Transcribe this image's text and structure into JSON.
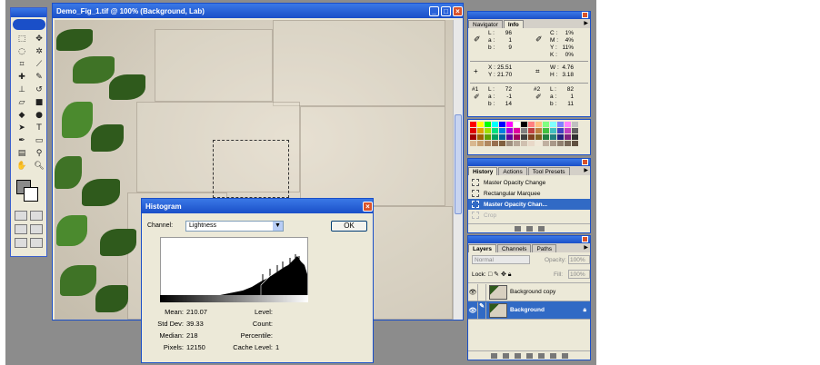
{
  "document": {
    "title": "Demo_Fig_1.tif @ 100% (Background, Lab)"
  },
  "histogram": {
    "title": "Histogram",
    "channel_label": "Channel:",
    "channel_value": "Lightness",
    "ok_label": "OK",
    "stats_left": [
      {
        "k": "Mean:",
        "v": "210.07"
      },
      {
        "k": "Std Dev:",
        "v": "39.33"
      },
      {
        "k": "Median:",
        "v": "218"
      },
      {
        "k": "Pixels:",
        "v": "12150"
      }
    ],
    "stats_right": [
      {
        "k": "Level:",
        "v": ""
      },
      {
        "k": "Count:",
        "v": ""
      },
      {
        "k": "Percentile:",
        "v": ""
      },
      {
        "k": "Cache Level:",
        "v": "1"
      }
    ]
  },
  "navigator": {
    "tabs": [
      "Navigator",
      "Info"
    ],
    "active_tab": "Info",
    "lab": [
      {
        "l": "L :",
        "v": "96"
      },
      {
        "l": "a :",
        "v": "1"
      },
      {
        "l": "b :",
        "v": "9"
      }
    ],
    "cmyk": [
      {
        "l": "C :",
        "v": "1%"
      },
      {
        "l": "M :",
        "v": "4%"
      },
      {
        "l": "Y :",
        "v": "11%"
      },
      {
        "l": "K :",
        "v": "0%"
      }
    ],
    "xy": [
      {
        "l": "X :",
        "v": "25.51"
      },
      {
        "l": "Y :",
        "v": "21.70"
      }
    ],
    "wh": [
      {
        "l": "W :",
        "v": "4.76"
      },
      {
        "l": "H :",
        "v": "3.18"
      }
    ],
    "s1_label": "#1",
    "s1": [
      {
        "l": "L :",
        "v": "72"
      },
      {
        "l": "a :",
        "v": "-1"
      },
      {
        "l": "b :",
        "v": "14"
      }
    ],
    "s2_label": "#2",
    "s2": [
      {
        "l": "L :",
        "v": "82"
      },
      {
        "l": "a :",
        "v": "1"
      },
      {
        "l": "b :",
        "v": "11"
      }
    ]
  },
  "history": {
    "tabs": [
      "History",
      "Actions",
      "Tool Presets"
    ],
    "items": [
      {
        "label": "Master Opacity Change",
        "state": "normal"
      },
      {
        "label": "Rectangular Marquee",
        "state": "normal"
      },
      {
        "label": "Master Opacity Chan...",
        "state": "selected"
      },
      {
        "label": "Crop",
        "state": "dim"
      }
    ]
  },
  "layers": {
    "tabs": [
      "Layers",
      "Channels",
      "Paths"
    ],
    "blend_mode": "Normal",
    "opacity_label": "Opacity:",
    "opacity_value": "100%",
    "lock_label": "Lock:",
    "fill_label": "Fill:",
    "fill_value": "100%",
    "items": [
      {
        "label": "Background copy",
        "selected": false
      },
      {
        "label": "Background",
        "selected": true
      }
    ]
  },
  "swatch_colors": [
    "#ff0000",
    "#ffff00",
    "#00ff00",
    "#00ffff",
    "#0000ff",
    "#ff00ff",
    "#ffffff",
    "#000000",
    "#ff8080",
    "#ffc080",
    "#80ff80",
    "#80ffff",
    "#8080ff",
    "#ff80ff",
    "#c0c0c0"
  ]
}
